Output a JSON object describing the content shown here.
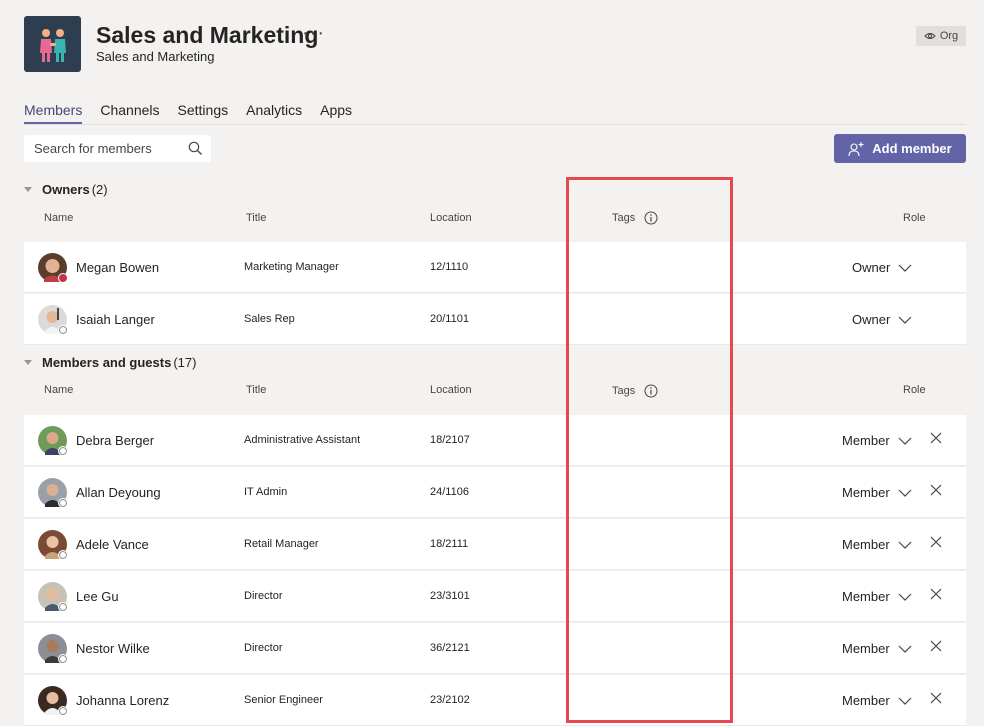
{
  "team": {
    "name": "Sales and Marketing",
    "subtitle": "Sales and Marketing",
    "more_icon": "more-icon",
    "org_label": "Org"
  },
  "tabs": [
    {
      "label": "Members",
      "active": true
    },
    {
      "label": "Channels"
    },
    {
      "label": "Settings"
    },
    {
      "label": "Analytics"
    },
    {
      "label": "Apps"
    }
  ],
  "search": {
    "placeholder": "Search for members"
  },
  "add_member": {
    "label": "Add member"
  },
  "columns": {
    "name": "Name",
    "title": "Title",
    "location": "Location",
    "tags": "Tags",
    "role": "Role"
  },
  "owners": {
    "title": "Owners",
    "count": "(2)",
    "rows": [
      {
        "name": "Megan Bowen",
        "title": "Marketing Manager",
        "location": "12/1110",
        "role": "Owner",
        "presence": "busy"
      },
      {
        "name": "Isaiah Langer",
        "title": "Sales Rep",
        "location": "20/1101",
        "role": "Owner",
        "presence": "offline"
      }
    ]
  },
  "members": {
    "title": "Members and guests",
    "count": "(17)",
    "rows": [
      {
        "name": "Debra Berger",
        "title": "Administrative Assistant",
        "location": "18/2107",
        "role": "Member"
      },
      {
        "name": "Allan Deyoung",
        "title": "IT Admin",
        "location": "24/1106",
        "role": "Member"
      },
      {
        "name": "Adele Vance",
        "title": "Retail Manager",
        "location": "18/2111",
        "role": "Member"
      },
      {
        "name": "Lee Gu",
        "title": "Director",
        "location": "23/3101",
        "role": "Member"
      },
      {
        "name": "Nestor Wilke",
        "title": "Director",
        "location": "36/2121",
        "role": "Member"
      },
      {
        "name": "Johanna Lorenz",
        "title": "Senior Engineer",
        "location": "23/2102",
        "role": "Member"
      }
    ]
  },
  "colors": {
    "accent": "#6264a7",
    "highlight": "#e8474f",
    "busy": "#c4314b"
  }
}
